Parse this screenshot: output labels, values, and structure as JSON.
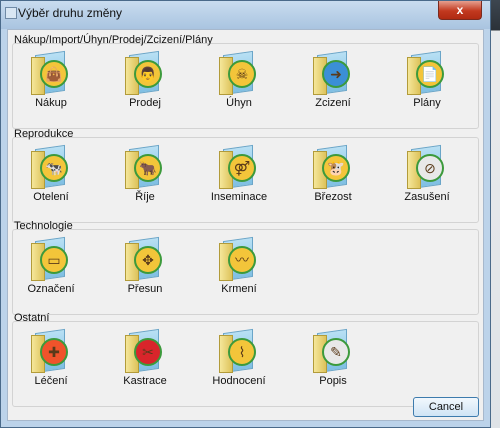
{
  "window": {
    "title": "Výběr druhu změny",
    "close_label": "x"
  },
  "groups": [
    {
      "label": "Nákup/Import/Úhyn/Prodej/Zcizení/Plány",
      "items": [
        {
          "label": "Nákup",
          "icon": "shopping-bag-icon",
          "glyph": "👜",
          "color": "#f3c53a"
        },
        {
          "label": "Prodej",
          "icon": "farmer-icon",
          "glyph": "👨",
          "color": "#f3c53a"
        },
        {
          "label": "Úhyn",
          "icon": "skull-icon",
          "glyph": "☠",
          "color": "#f3c53a"
        },
        {
          "label": "Zcizení",
          "icon": "arrow-right-icon",
          "glyph": "➜",
          "color": "#3b8fd6"
        },
        {
          "label": "Plány",
          "icon": "document-icon",
          "glyph": "📄",
          "color": "#f3c53a"
        }
      ]
    },
    {
      "label": "Reprodukce",
      "items": [
        {
          "label": "Otelení",
          "icon": "calf-icon",
          "glyph": "🐄",
          "color": "#f3c53a"
        },
        {
          "label": "Říje",
          "icon": "cow-icon",
          "glyph": "🐂",
          "color": "#f3c53a"
        },
        {
          "label": "Inseminace",
          "icon": "gender-rings-icon",
          "glyph": "⚤",
          "color": "#f3c53a"
        },
        {
          "label": "Březost",
          "icon": "pregnant-cow-icon",
          "glyph": "🐮",
          "color": "#f3c53a"
        },
        {
          "label": "Zasušení",
          "icon": "no-milk-icon",
          "glyph": "⊘",
          "color": "#e8e8e8"
        }
      ]
    },
    {
      "label": "Technologie",
      "items": [
        {
          "label": "Označení",
          "icon": "tag-icon",
          "glyph": "▭",
          "color": "#f3c53a"
        },
        {
          "label": "Přesun",
          "icon": "move-arrows-icon",
          "glyph": "✥",
          "color": "#f3c53a"
        },
        {
          "label": "Krmení",
          "icon": "feed-icon",
          "glyph": "〰",
          "color": "#f3c53a"
        }
      ]
    },
    {
      "label": "Ostatní",
      "items": [
        {
          "label": "Léčení",
          "icon": "medical-cross-icon",
          "glyph": "✚",
          "color": "#f0532b"
        },
        {
          "label": "Kastrace",
          "icon": "castration-icon",
          "glyph": "✂",
          "color": "#d9252b"
        },
        {
          "label": "Hodnocení",
          "icon": "chart-line-icon",
          "glyph": "⌇",
          "color": "#f3c53a"
        },
        {
          "label": "Popis",
          "icon": "pencil-icon",
          "glyph": "✎",
          "color": "#e8e8e8"
        }
      ]
    }
  ],
  "buttons": {
    "cancel_label": "Cancel"
  }
}
